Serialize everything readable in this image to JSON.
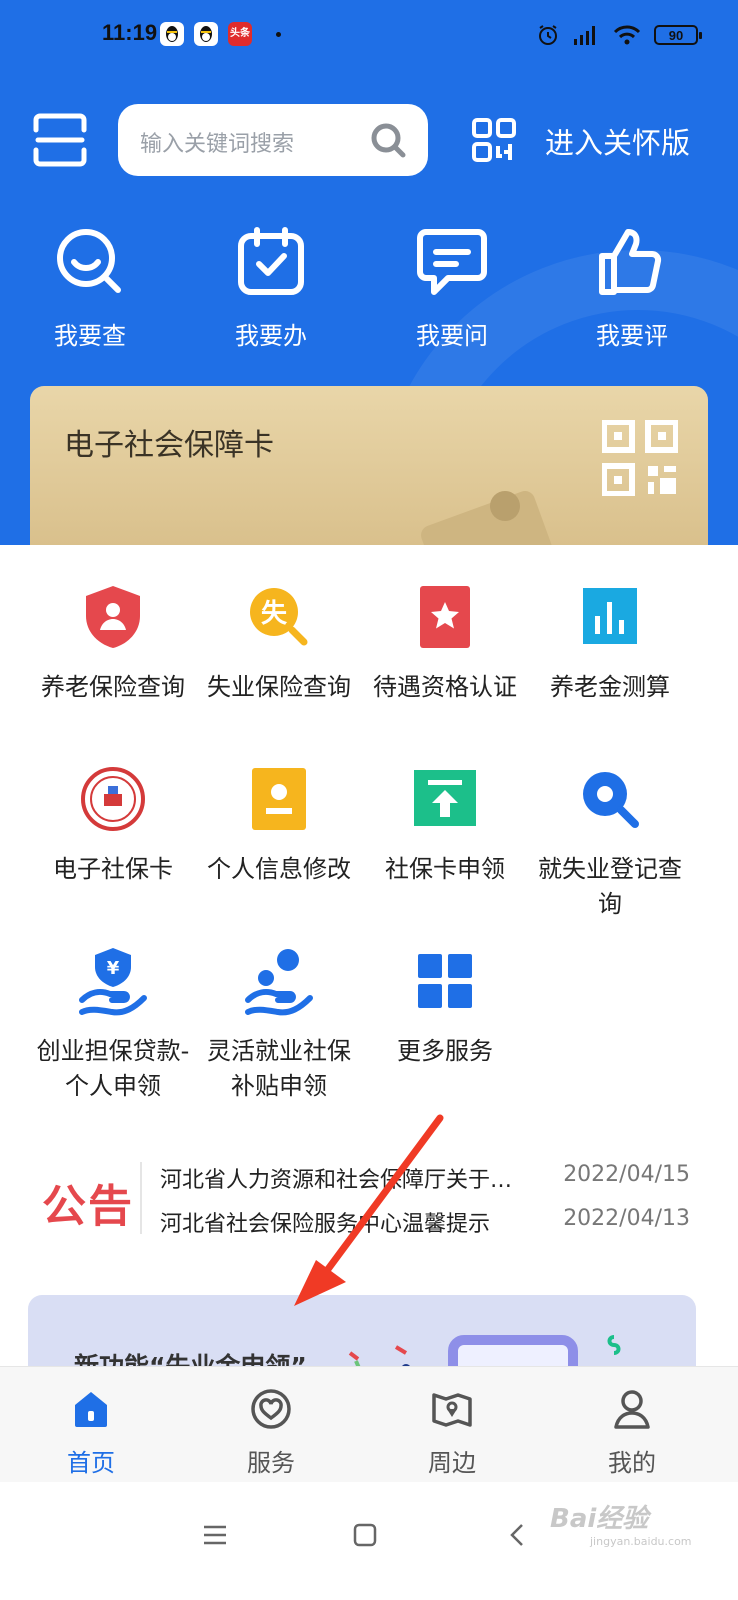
{
  "status_bar": {
    "time": "11:19",
    "app_badge": "头条",
    "battery": "90"
  },
  "header": {
    "search_placeholder": "输入关键词搜索",
    "care_mode_label": "进入关怀版"
  },
  "quick_actions": [
    {
      "label": "我要查",
      "icon": "search-smile-icon"
    },
    {
      "label": "我要办",
      "icon": "calendar-check-icon"
    },
    {
      "label": "我要问",
      "icon": "chat-bubble-icon"
    },
    {
      "label": "我要评",
      "icon": "thumbs-up-icon"
    }
  ],
  "card": {
    "title": "电子社会保障卡",
    "icon": "qr-code-icon"
  },
  "services": [
    {
      "label": "养老保险查询",
      "icon": "pension-shield-icon",
      "color": "#e5484d"
    },
    {
      "label": "失业保险查询",
      "icon": "unemployment-search-icon",
      "color": "#f6b51e",
      "glyph": "失"
    },
    {
      "label": "待遇资格认证",
      "icon": "certificate-star-icon",
      "color": "#e5484d"
    },
    {
      "label": "养老金测算",
      "icon": "bar-chart-icon",
      "color": "#1aa9e1"
    },
    {
      "label": "电子社保卡",
      "icon": "social-security-seal-icon",
      "color": "#d43a3a"
    },
    {
      "label": "个人信息修改",
      "icon": "person-card-icon",
      "color": "#f6b51e"
    },
    {
      "label": "社保卡申领",
      "icon": "upload-arrow-icon",
      "color": "#1cbf8a"
    },
    {
      "label": "就失业登记查询",
      "icon": "magnifier-icon",
      "color": "#1f6fe6"
    },
    {
      "label": "创业担保贷款-个人申领",
      "icon": "loan-hand-icon",
      "color": "#1f6fe6"
    },
    {
      "label": "灵活就业社保补贴申领",
      "icon": "subsidy-hand-icon",
      "color": "#1f6fe6"
    },
    {
      "label": "更多服务",
      "icon": "grid-icon",
      "color": "#1f6fe6"
    }
  ],
  "notices": {
    "logo": "公告",
    "items": [
      {
        "title": "河北省人力资源和社会保障厅关于…",
        "date": "2022/04/15"
      },
      {
        "title": "河北省社会保险服务中心温馨提示",
        "date": "2022/04/13"
      }
    ]
  },
  "banner": {
    "title": "新功能“失业金申领”"
  },
  "bottom_nav": [
    {
      "label": "首页",
      "icon": "home-icon",
      "active": true
    },
    {
      "label": "服务",
      "icon": "heart-circle-icon",
      "active": false
    },
    {
      "label": "周边",
      "icon": "map-pin-icon",
      "active": false
    },
    {
      "label": "我的",
      "icon": "user-icon",
      "active": false
    }
  ],
  "watermark": {
    "text": "Bai经验",
    "sub": "jingyan.baidu.com"
  },
  "colors": {
    "primary": "#1f6fe6",
    "notice_red": "#e5484d",
    "card_gold": "#e2cc9b"
  }
}
